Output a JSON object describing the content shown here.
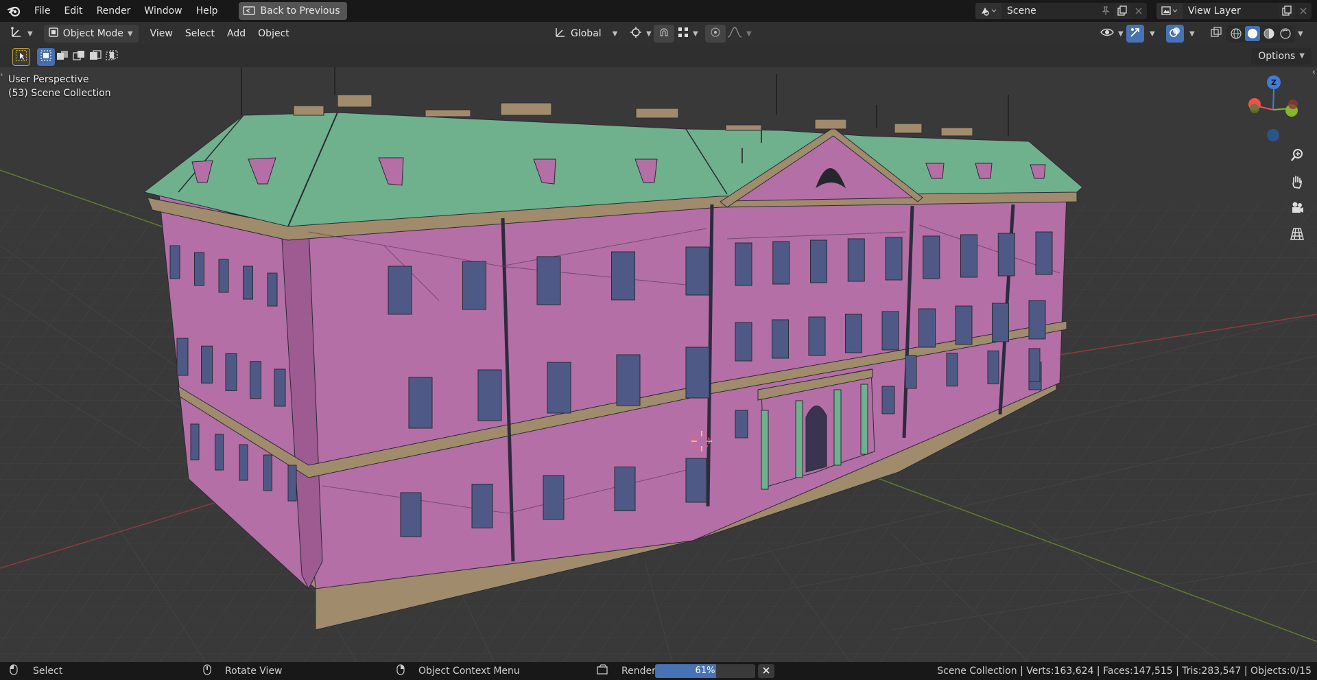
{
  "topbar": {
    "menus": [
      "File",
      "Edit",
      "Render",
      "Window",
      "Help"
    ],
    "back_button": "Back to Previous",
    "scene_name": "Scene",
    "view_layer": "View Layer"
  },
  "header": {
    "mode": "Object Mode",
    "menus": [
      "View",
      "Select",
      "Add",
      "Object"
    ],
    "transform_orientation": "Global"
  },
  "toolrow": {
    "options": "Options"
  },
  "viewport": {
    "perspective": "User Perspective",
    "collection": "(53) Scene Collection",
    "gizmo": {
      "z": "Z",
      "x_color": "#f0524b",
      "y_color": "#83b82b",
      "z_color": "#3d7ed9"
    }
  },
  "statusbar": {
    "select": "Select",
    "rotate": "Rotate View",
    "context_menu": "Object Context Menu",
    "render": "Render",
    "progress_label": "61%",
    "progress_value": 0.61,
    "stats": "Scene Collection | Verts:163,624 | Faces:147,515 | Tris:283,547 | Objects:0/15"
  },
  "colors": {
    "wall": "#b46fa6",
    "roof": "#6fb08d",
    "trim": "#a08b6c",
    "window": "#4e5a85",
    "accent": "#4772b3"
  }
}
